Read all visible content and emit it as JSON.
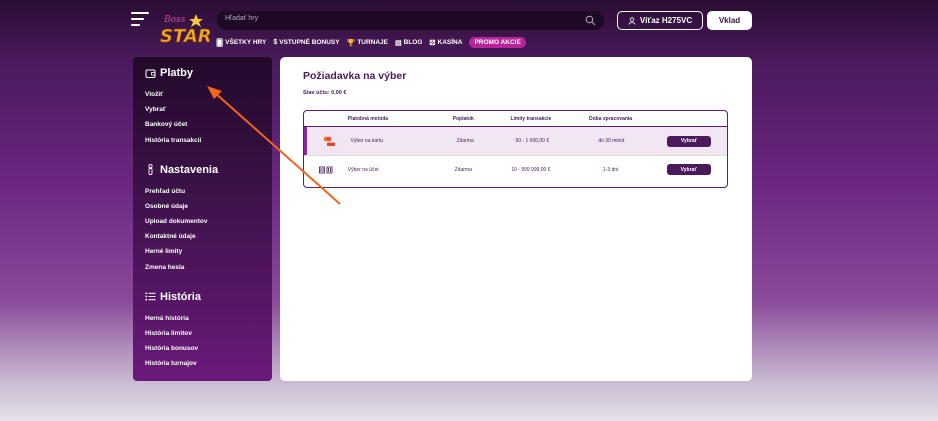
{
  "header": {
    "search_placeholder": "Hľadať hry",
    "user_label": "Víťaz H275VC",
    "deposit_label": "Vklad",
    "nav": [
      {
        "icon": "cards-icon",
        "label": "VŠETKY HRY"
      },
      {
        "icon": "dollar-icon",
        "label": "VSTUPNÉ BONUSY"
      },
      {
        "icon": "trophy-icon",
        "label": "TURNAJE"
      },
      {
        "icon": "blog-icon",
        "label": "BLOG"
      },
      {
        "icon": "dice-icon",
        "label": "KASÍNA"
      }
    ],
    "promo_label": "PROMO AKCIE"
  },
  "sidebar": {
    "payments": {
      "title": "Platby",
      "icon": "wallet-icon",
      "items": [
        "Vložiť",
        "Vybrať",
        "Bankový účet",
        "História transakcií"
      ]
    },
    "settings": {
      "title": "Nastavenia",
      "icon": "person-icon",
      "items": [
        "Prehľad účtu",
        "Osobné údaje",
        "Upload dokumentov",
        "Kontaktné údaje",
        "Herné limity",
        "Zmena hesla"
      ]
    },
    "history": {
      "title": "História",
      "icon": "list-icon",
      "items": [
        "Herná história",
        "História limitov",
        "História bonusov",
        "História turnajov"
      ]
    }
  },
  "main": {
    "title": "Požiadavka na výber",
    "balance": "Stav účtu: 0,00 €",
    "columns": [
      "Platobná metóda",
      "Poplatok",
      "Limity transakcie",
      "Doba spracovania"
    ],
    "rows": [
      {
        "method": "Výber na kartu",
        "fee": "Zdarma",
        "limits": "50 - 1 000,00 €",
        "time": "do 30 minút",
        "button": "Vybrať",
        "icon": "card-provider-icon"
      },
      {
        "method": "Výber na účet",
        "fee": "Zdarma",
        "limits": "10 - 999 999,00 €",
        "time": "1-3 dni",
        "button": "Vybrať",
        "icon": "bank-icon"
      }
    ]
  },
  "colors": {
    "accent": "#4a1a5c",
    "promo": "#b8249a",
    "annotation_arrow": "#f0641e"
  }
}
